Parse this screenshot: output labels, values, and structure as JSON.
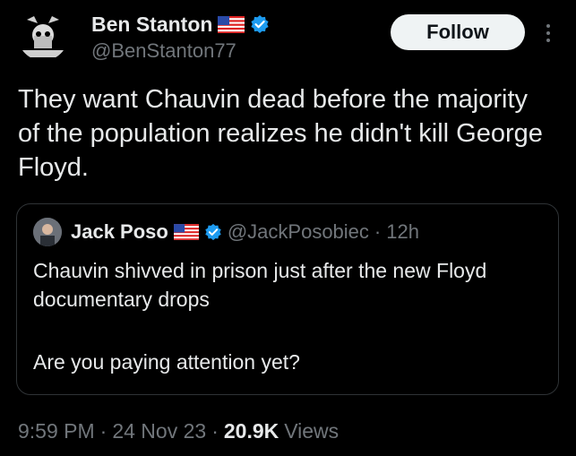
{
  "author": {
    "display_name": "Ben Stanton",
    "handle": "@BenStanton77",
    "avatar_text": "BEN STANTON",
    "flag_icon": "us-flag-icon",
    "verified_icon": "verified-badge-icon"
  },
  "actions": {
    "follow_label": "Follow",
    "more_icon": "more-options-icon"
  },
  "tweet": {
    "text": "They want Chauvin dead before the majority of the population realizes he didn't kill George Floyd."
  },
  "quoted": {
    "display_name": "Jack Poso",
    "handle": "@JackPosobiec",
    "separator": "·",
    "time": "12h",
    "text_line1": "Chauvin shivved in prison just after the new Floyd documentary drops",
    "text_line2": "Are you paying attention yet?"
  },
  "meta": {
    "time": "9:59 PM",
    "sep1": "·",
    "date": "24 Nov 23",
    "sep2": "·",
    "views_count": "20.9K",
    "views_label": "Views"
  },
  "colors": {
    "background": "#000000",
    "text_primary": "#e7e9ea",
    "text_secondary": "#71767b",
    "verified_blue": "#1d9bf0",
    "border": "#2f3336"
  }
}
